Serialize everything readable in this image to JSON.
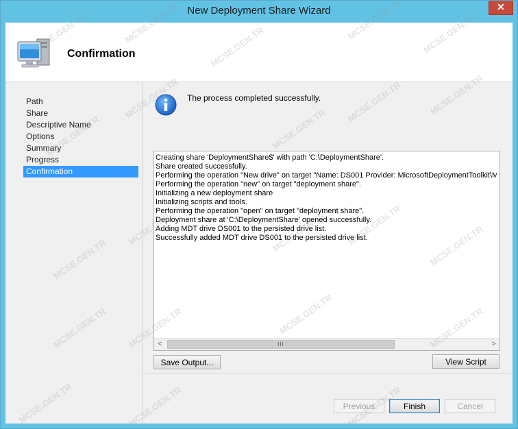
{
  "window": {
    "title": "New Deployment Share Wizard",
    "close_glyph": "✕"
  },
  "header": {
    "title": "Confirmation",
    "icon": "computer-icon"
  },
  "nav": {
    "items": [
      {
        "label": "Path",
        "active": false
      },
      {
        "label": "Share",
        "active": false
      },
      {
        "label": "Descriptive Name",
        "active": false
      },
      {
        "label": "Options",
        "active": false
      },
      {
        "label": "Summary",
        "active": false
      },
      {
        "label": "Progress",
        "active": false
      },
      {
        "label": "Confirmation",
        "active": true
      }
    ]
  },
  "content": {
    "status_icon": "info-icon",
    "status_message": "The process completed successfully.",
    "log_lines": [
      "Creating share 'DeploymentShare$' with path 'C:\\DeploymentShare'.",
      "Share created successfully.",
      "Performing the operation \"New drive\" on target \"Name: DS001 Provider: MicrosoftDeploymentToolkit\\MI",
      "Performing the operation \"new\" on target \"deployment share\".",
      "Initializing a new deployment share",
      "Initializing scripts and tools.",
      "Performing the operation \"open\" on target \"deployment share\".",
      "Deployment share at 'C:\\DeploymentShare' opened successfully.",
      "Adding MDT drive DS001 to the persisted drive list.",
      "Successfully added MDT drive DS001 to the persisted drive list."
    ],
    "scroll": {
      "left_arrow": "<",
      "right_arrow": ">",
      "thumb_grip": "III"
    }
  },
  "buttons": {
    "save_output": "Save Output...",
    "view_script": "View Script",
    "previous": "Previous",
    "finish": "Finish",
    "cancel": "Cancel"
  },
  "watermark_text": "MCSE.GEN.TR"
}
